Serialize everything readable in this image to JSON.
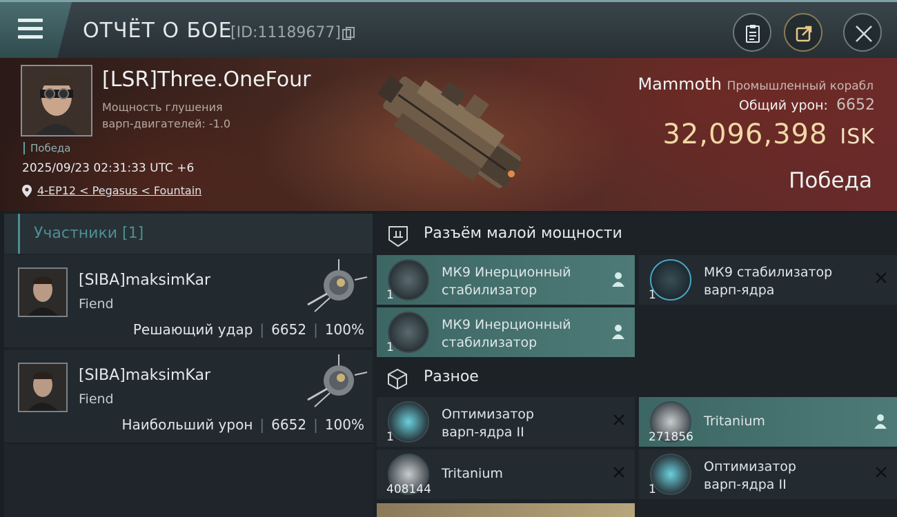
{
  "header": {
    "title": "ОТЧЁТ О БОЕ",
    "report_id": "[ID:11189677]",
    "icons": [
      "menu-icon",
      "copy-icon",
      "clipboard-icon",
      "share-icon",
      "close-icon"
    ]
  },
  "victim": {
    "name": "[LSR]Three.OneFour",
    "attribute_line1": "Мощность глушения",
    "attribute_line2": "варп-двигателей: -1.0",
    "result_small": "Победа",
    "datetime": "2025/09/23 02:31:33 UTC +6",
    "location": "4-EP12 < Pegasus < Fountain",
    "ship_name": "Mammoth",
    "ship_class": "Промышленный корабл",
    "total_damage_label": "Общий урон:",
    "total_damage_value": "6652",
    "isk_value": "32,096,398",
    "isk_unit": "ISK",
    "result_big": "Победа"
  },
  "participants": {
    "header": "Участники [1]",
    "attackers": [
      {
        "name": "[SIBA]maksimKar",
        "ship": "Fiend",
        "role": "Решающий удар",
        "damage": "6652",
        "percent": "100%"
      },
      {
        "name": "[SIBA]maksimKar",
        "ship": "Fiend",
        "role": "Наибольший урон",
        "damage": "6652",
        "percent": "100%"
      }
    ]
  },
  "fitting": {
    "low_slots_header": "Разъём малой мощности",
    "misc_header": "Разное",
    "low_slots": [
      {
        "line1": "МК9 Инерционный",
        "line2": "стабилизатор",
        "qty": "1",
        "status": "dropped"
      },
      {
        "line1": "МК9 стабилизатор",
        "line2": "варп-ядра",
        "qty": "1",
        "status": "destroyed"
      },
      {
        "line1": "МК9 Инерционный",
        "line2": "стабилизатор",
        "qty": "1",
        "status": "dropped"
      }
    ],
    "misc": [
      {
        "line1": "Оптимизатор",
        "line2": "варп-ядра II",
        "qty": "1",
        "status": "destroyed"
      },
      {
        "line1": "Tritanium",
        "line2": "",
        "qty": "271856",
        "status": "dropped"
      },
      {
        "line1": "Tritanium",
        "line2": "",
        "qty": "408144",
        "status": "destroyed"
      },
      {
        "line1": "Оптимизатор",
        "line2": "варп-ядра II",
        "qty": "1",
        "status": "destroyed"
      }
    ]
  },
  "colors": {
    "accent": "#4d8f93",
    "dropped": "#4d7a77",
    "isk": "#f1d9a6"
  }
}
